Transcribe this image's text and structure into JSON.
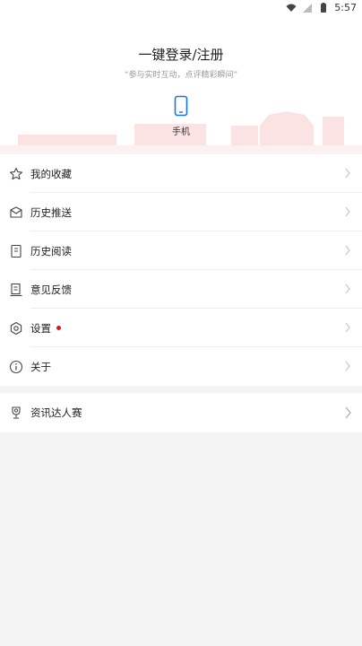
{
  "status": {
    "time": "5:57"
  },
  "header": {
    "title": "一键登录/注册",
    "subtitle": "“参与实时互动，点评精彩瞬间”",
    "phone_label": "手机"
  },
  "menu": [
    {
      "label": "我的收藏",
      "icon": "star-icon"
    },
    {
      "label": "历史推送",
      "icon": "envelope-icon"
    },
    {
      "label": "历史阅读",
      "icon": "book-icon"
    },
    {
      "label": "意见反馈",
      "icon": "feedback-icon"
    },
    {
      "label": "设置",
      "icon": "settings-icon",
      "badge": true
    },
    {
      "label": "关于",
      "icon": "info-icon"
    }
  ],
  "extra": {
    "label": "资讯达人赛",
    "icon": "trophy-icon"
  },
  "colors": {
    "badge": "#e4141b",
    "accent": "#1a73e8"
  }
}
